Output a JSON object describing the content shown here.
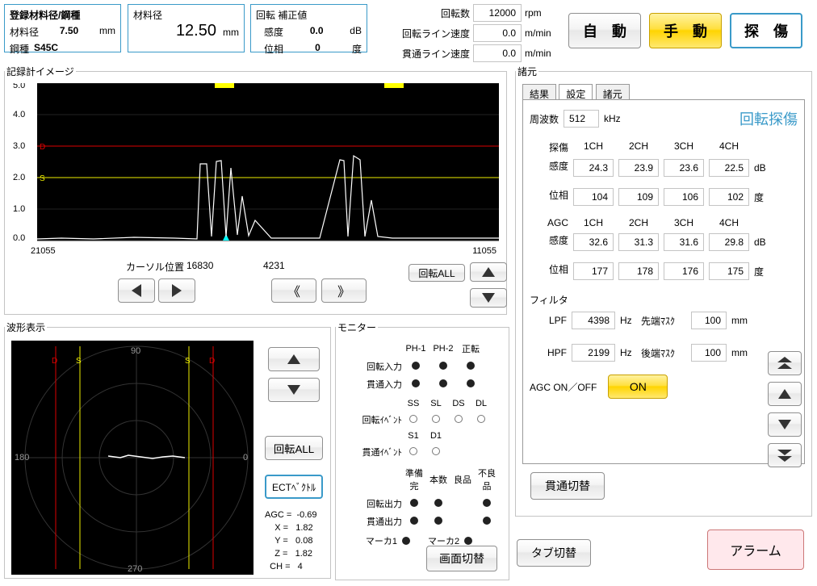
{
  "registered": {
    "title": "登録材料径/鋼種",
    "diameter_label": "材料径",
    "diameter_val": "7.50",
    "diameter_unit": "mm",
    "steel_label": "鋼種",
    "steel_val": "S45C"
  },
  "material": {
    "label": "材料径",
    "val": "12.50",
    "unit": "mm"
  },
  "correction": {
    "title": "回転 補正値",
    "sens_label": "感度",
    "sens_val": "0.0",
    "sens_unit": "dB",
    "phase_label": "位相",
    "phase_val": "0",
    "phase_unit": "度"
  },
  "spinrow": {
    "rpm_label": "回転数",
    "rpm_val": "12000",
    "rpm_unit": "rpm",
    "rot_line_label": "回転ライン速度",
    "rot_line_val": "0.0",
    "rot_line_unit": "m/min",
    "thru_line_label": "貫通ライン速度",
    "thru_line_val": "0.0",
    "thru_line_unit": "m/min"
  },
  "main_buttons": {
    "auto": "自　動",
    "manual": "手　動",
    "flaw": "探　傷"
  },
  "recorder": {
    "legend": "記録計イメージ",
    "ticks": [
      "5.0",
      "4.0",
      "3.0",
      "2.0",
      "1.0",
      "0.0"
    ],
    "xmin": "21055",
    "xmax": "11055",
    "cursor_label": "カーソル位置",
    "cursor_val": "16830",
    "offset_val": "4231",
    "rotate_all": "回転ALL"
  },
  "waveform": {
    "legend": "波形表示",
    "deg0": "0",
    "deg90": "90",
    "deg180": "180",
    "deg270": "270",
    "rotate_all": "回転ALL",
    "ect": "ECTﾍﾞｸﾄﾙ",
    "agc": "AGC =",
    "agc_v": "-0.69",
    "x": "X =",
    "x_v": "1.82",
    "y": "Y =",
    "y_v": "0.08",
    "z": "Z =",
    "z_v": "1.82",
    "ch": "CH =",
    "ch_v": "4"
  },
  "monitor": {
    "legend": "モニター",
    "ph1": "PH-1",
    "ph2": "PH-2",
    "fwd": "正転",
    "rot_in": "回転入力",
    "thru_in": "貫通入力",
    "ss": "SS",
    "sl": "SL",
    "ds": "DS",
    "dl": "DL",
    "rot_evt": "回転ｲﾍﾞﾝﾄ",
    "thru_evt": "貫通ｲﾍﾞﾝﾄ",
    "s1": "S1",
    "d1": "D1",
    "prep": "準備完",
    "cnt": "本数",
    "good": "良品",
    "bad": "不良品",
    "rot_out": "回転出力",
    "thru_out": "貫通出力",
    "marker1": "マーカ1",
    "marker2": "マーカ2",
    "screen_switch": "画面切替"
  },
  "spec": {
    "legend": "諸元",
    "tab_result": "結果",
    "tab_set": "設定",
    "tab_spec": "諸元",
    "freq_label": "周波数",
    "freq_val": "512",
    "khz": "kHz",
    "rotflaw": "回転探傷",
    "flaw": "探傷",
    "ch1": "1CH",
    "ch2": "2CH",
    "ch3": "3CH",
    "ch4": "4CH",
    "sens": "感度",
    "phase": "位相",
    "db": "dB",
    "deg": "度",
    "flaw_sens": [
      "24.3",
      "23.9",
      "23.6",
      "22.5"
    ],
    "flaw_phase": [
      "104",
      "109",
      "106",
      "102"
    ],
    "agc": "AGC",
    "agc_sens": [
      "32.6",
      "31.3",
      "31.6",
      "29.8"
    ],
    "agc_phase": [
      "177",
      "178",
      "176",
      "175"
    ],
    "filter": "フィルタ",
    "lpf": "LPF",
    "lpf_v": "4398",
    "hz": "Hz",
    "tip_mask": "先端ﾏｽｸ",
    "tip_v": "100",
    "mm": "mm",
    "hpf": "HPF",
    "hpf_v": "2199",
    "end_mask": "後端ﾏｽｸ",
    "end_v": "100",
    "agc_onoff": "AGC  ON／OFF",
    "on": "ON",
    "thru_switch": "貫通切替",
    "tab_switch": "タブ切替",
    "alarm": "アラーム"
  },
  "chart_data": {
    "type": "line",
    "title": "記録計イメージ",
    "ylim": [
      0,
      5
    ],
    "xrange": [
      21055,
      11055
    ],
    "thresholds": {
      "D": 3.0,
      "S": 2.0
    },
    "x": [
      21055,
      19500,
      18200,
      17900,
      17500,
      17200,
      17000,
      16600,
      16400,
      16200,
      16000,
      15500,
      14800,
      14400,
      14200,
      14000,
      13800,
      13600,
      13000,
      12500,
      11500,
      11055
    ],
    "y": [
      0.05,
      0.1,
      0.1,
      2.5,
      0.2,
      2.7,
      0.3,
      2.3,
      0.3,
      1.3,
      0.2,
      0.1,
      0.1,
      2.4,
      0.2,
      2.5,
      0.2,
      1.2,
      0.1,
      0.05,
      0.05,
      0.05
    ]
  }
}
